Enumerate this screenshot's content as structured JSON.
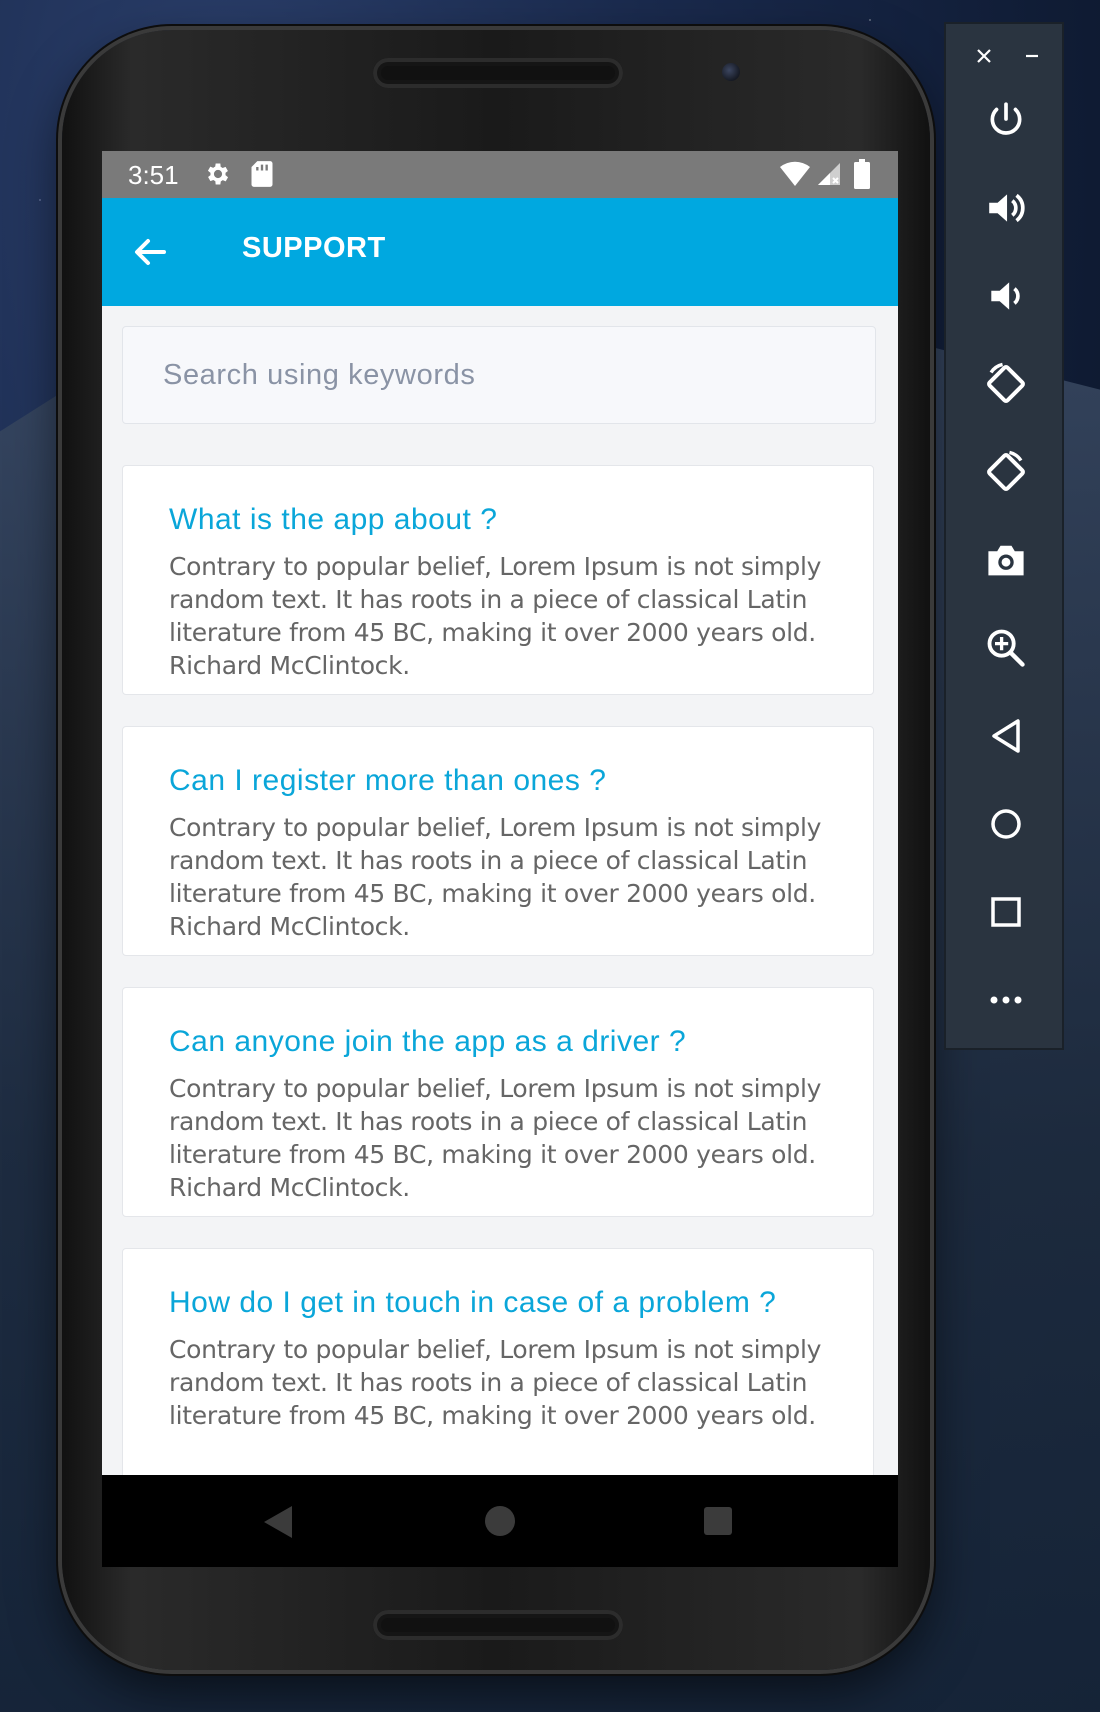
{
  "status_bar": {
    "time": "3:51"
  },
  "app_bar": {
    "title": "SUPPORT"
  },
  "search": {
    "placeholder": "Search using keywords",
    "value": ""
  },
  "faq": [
    {
      "question": "What is the app about ?",
      "answer": "Contrary to popular belief, Lorem Ipsum is not simply random text. It has roots in a piece of classical Latin literature from 45 BC, making it over 2000 years old. Richard McClintock."
    },
    {
      "question": "Can I register more than ones ?",
      "answer": "Contrary to popular belief, Lorem Ipsum is not simply random text. It has roots in a piece of classical Latin literature from 45 BC, making it over 2000 years old. Richard McClintock."
    },
    {
      "question": "Can anyone join the app as a driver ?",
      "answer": "Contrary to popular belief, Lorem Ipsum is not simply random text. It has roots in a piece of classical Latin literature from 45 BC, making it over 2000 years old. Richard McClintock."
    },
    {
      "question": "How do I get in touch in case of a problem ?",
      "answer": "Contrary to popular belief, Lorem Ipsum is not simply random text. It has roots in a piece of classical Latin literature from 45 BC, making it over 2000 years old."
    }
  ],
  "emulator_panel": {
    "icons": [
      "power-icon",
      "volume-up-icon",
      "volume-down-icon",
      "rotate-left-icon",
      "rotate-right-icon",
      "camera-icon",
      "zoom-icon",
      "back-icon",
      "home-icon",
      "overview-icon",
      "more-icon"
    ]
  },
  "colors": {
    "accent": "#00a8e0",
    "question_text": "#0aa6d9",
    "answer_text": "#666666",
    "status_bar": "#7a7a7a"
  }
}
